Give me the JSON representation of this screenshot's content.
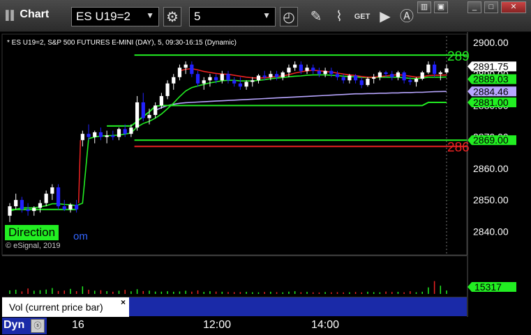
{
  "window": {
    "title": "Chart",
    "symbol": "ES U19=2",
    "interval": "5"
  },
  "info_line": "* ES U19=2, S&P 500 FUTURES E-MINI (DAY), 5, 09:30-16:15 (Dynamic)",
  "direction_label": "Direction",
  "site_fragment": "om",
  "copyright": "© eSignal, 2019",
  "volume_panel": {
    "label": "Vol (current price bar)",
    "close_icon": "×",
    "value_tag": "15317"
  },
  "bottom": {
    "dyn_label": "Dyn"
  },
  "line_labels": {
    "top_right": "289",
    "red_right": "286"
  },
  "colors": {
    "background": "#000000",
    "up_candle": "#ffffff",
    "down_candle": "#2222ff",
    "green_line": "#22ee22",
    "red_line": "#ee2222",
    "purple_line": "#b8a6ff",
    "price_tag_last": "#ffffff",
    "price_tag_green": "#22ee22",
    "price_tag_purple": "#b8a6ff",
    "axis_text": "#ffffff"
  },
  "chart_data": {
    "type": "candlestick",
    "y_axis": {
      "min": 2833,
      "max": 2902,
      "ticks": [
        2840,
        2850,
        2860,
        2870,
        2880,
        2890,
        2900
      ],
      "tick_labels": [
        "2840.00",
        "2850.00",
        "2860.00",
        "2870.00",
        "2880.00",
        "2890.00",
        "2900.00"
      ]
    },
    "x_axis": {
      "tick_labels": [
        "16",
        "12:00",
        "14:00"
      ]
    },
    "price_tags": [
      {
        "value": 2891.75,
        "label": "2891.75",
        "kind": "last"
      },
      {
        "value": 2889.03,
        "label": "2889.03",
        "kind": "green"
      },
      {
        "value": 2884.46,
        "label": "2884.46",
        "kind": "purple"
      },
      {
        "value": 2881.0,
        "label": "2881.00",
        "kind": "green"
      },
      {
        "value": 2869.0,
        "label": "2869.00",
        "kind": "green"
      }
    ],
    "horizontal_lines": [
      {
        "value": 2896,
        "color": "green",
        "from_bar": 21
      },
      {
        "value": 2869,
        "color": "green",
        "from_bar": 21
      },
      {
        "value": 2867,
        "color": "red",
        "from_bar": 21
      }
    ],
    "candles": [
      [
        2845.0,
        2849.0,
        2843.0,
        2848.0
      ],
      [
        2848.0,
        2852.0,
        2847.0,
        2850.0
      ],
      [
        2850.0,
        2851.0,
        2846.0,
        2847.0
      ],
      [
        2847.0,
        2849.0,
        2845.0,
        2846.5
      ],
      [
        2846.5,
        2848.0,
        2845.0,
        2847.5
      ],
      [
        2847.5,
        2850.0,
        2846.0,
        2849.0
      ],
      [
        2849.0,
        2853.0,
        2848.0,
        2852.0
      ],
      [
        2852.0,
        2855.0,
        2850.0,
        2854.0
      ],
      [
        2854.0,
        2855.0,
        2847.0,
        2848.0
      ],
      [
        2848.0,
        2850.0,
        2846.5,
        2847.0
      ],
      [
        2847.0,
        2849.0,
        2846.0,
        2848.5
      ],
      [
        2848.5,
        2850.0,
        2846.0,
        2847.0
      ],
      [
        2869.0,
        2872.0,
        2867.0,
        2871.0
      ],
      [
        2871.0,
        2874.0,
        2869.0,
        2870.0
      ],
      [
        2870.0,
        2872.0,
        2868.0,
        2871.5
      ],
      [
        2871.5,
        2873.0,
        2869.0,
        2870.0
      ],
      [
        2870.0,
        2872.0,
        2868.0,
        2870.5
      ],
      [
        2870.5,
        2872.0,
        2869.0,
        2870.0
      ],
      [
        2870.0,
        2873.0,
        2869.0,
        2872.5
      ],
      [
        2872.5,
        2874.0,
        2870.0,
        2871.0
      ],
      [
        2871.0,
        2874.0,
        2870.0,
        2873.0
      ],
      [
        2873.0,
        2883.0,
        2872.0,
        2881.0
      ],
      [
        2881.0,
        2884.0,
        2875.0,
        2876.0
      ],
      [
        2876.0,
        2879.0,
        2874.0,
        2877.0
      ],
      [
        2877.0,
        2881.0,
        2876.0,
        2880.0
      ],
      [
        2880.0,
        2884.0,
        2879.0,
        2883.0
      ],
      [
        2883.0,
        2888.0,
        2882.0,
        2887.0
      ],
      [
        2887.0,
        2890.0,
        2885.0,
        2889.0
      ],
      [
        2889.0,
        2893.0,
        2888.0,
        2892.0
      ],
      [
        2892.0,
        2894.0,
        2890.0,
        2893.0
      ],
      [
        2893.0,
        2894.0,
        2889.0,
        2890.0
      ],
      [
        2890.0,
        2891.0,
        2886.0,
        2887.0
      ],
      [
        2887.0,
        2889.0,
        2885.0,
        2888.0
      ],
      [
        2888.0,
        2890.0,
        2886.0,
        2889.0
      ],
      [
        2889.0,
        2890.0,
        2887.0,
        2888.0
      ],
      [
        2888.0,
        2891.0,
        2887.0,
        2890.0
      ],
      [
        2890.0,
        2891.0,
        2887.0,
        2888.0
      ],
      [
        2888.0,
        2889.0,
        2886.0,
        2887.0
      ],
      [
        2887.0,
        2889.0,
        2885.0,
        2886.0
      ],
      [
        2886.0,
        2888.0,
        2885.0,
        2887.5
      ],
      [
        2887.5,
        2889.0,
        2886.0,
        2888.0
      ],
      [
        2888.0,
        2890.0,
        2887.0,
        2889.5
      ],
      [
        2889.5,
        2891.0,
        2888.0,
        2889.0
      ],
      [
        2889.0,
        2891.0,
        2888.0,
        2890.0
      ],
      [
        2890.0,
        2891.0,
        2888.0,
        2889.0
      ],
      [
        2889.0,
        2891.0,
        2888.0,
        2890.5
      ],
      [
        2890.5,
        2893.0,
        2889.0,
        2892.0
      ],
      [
        2892.0,
        2894.0,
        2891.0,
        2893.0
      ],
      [
        2893.0,
        2894.0,
        2890.0,
        2891.0
      ],
      [
        2891.0,
        2893.0,
        2890.0,
        2892.0
      ],
      [
        2892.0,
        2893.0,
        2890.0,
        2891.0
      ],
      [
        2891.0,
        2892.0,
        2889.0,
        2890.0
      ],
      [
        2890.0,
        2892.0,
        2889.0,
        2891.0
      ],
      [
        2891.0,
        2892.0,
        2889.0,
        2890.0
      ],
      [
        2890.0,
        2891.0,
        2888.0,
        2889.0
      ],
      [
        2889.0,
        2890.0,
        2887.0,
        2888.0
      ],
      [
        2888.0,
        2890.0,
        2887.0,
        2889.5
      ],
      [
        2889.5,
        2890.0,
        2887.0,
        2888.0
      ],
      [
        2888.0,
        2889.0,
        2885.5,
        2886.5
      ],
      [
        2886.5,
        2889.0,
        2886.0,
        2888.5
      ],
      [
        2888.5,
        2890.0,
        2887.0,
        2889.0
      ],
      [
        2889.0,
        2891.0,
        2888.0,
        2890.5
      ],
      [
        2890.5,
        2891.0,
        2889.0,
        2890.0
      ],
      [
        2890.0,
        2891.0,
        2888.0,
        2889.0
      ],
      [
        2889.0,
        2891.0,
        2888.0,
        2890.5
      ],
      [
        2890.5,
        2891.0,
        2887.0,
        2888.0
      ],
      [
        2888.0,
        2889.0,
        2886.5,
        2887.5
      ],
      [
        2887.5,
        2889.0,
        2886.0,
        2888.5
      ],
      [
        2888.5,
        2891.0,
        2888.0,
        2890.5
      ],
      [
        2890.5,
        2894.0,
        2890.0,
        2893.0
      ],
      [
        2893.0,
        2894.0,
        2889.0,
        2890.0
      ],
      [
        2890.0,
        2891.0,
        2888.0,
        2890.5
      ],
      [
        2890.5,
        2893.0,
        2890.0,
        2891.75
      ]
    ],
    "green_ma": [
      2846.5,
      2847.0,
      2847.5,
      2847.5,
      2847.5,
      2847.8,
      2848.2,
      2848.8,
      2848.8,
      2848.6,
      2848.5,
      2848.2,
      2849.0,
      2869.5,
      2870.0,
      2870.3,
      2870.4,
      2870.5,
      2870.6,
      2870.9,
      2871.3,
      2873.2,
      2874.3,
      2875.0,
      2876.0,
      2877.3,
      2879.0,
      2880.8,
      2882.8,
      2884.6,
      2885.7,
      2886.2,
      2886.7,
      2887.2,
      2887.5,
      2887.9,
      2888.0,
      2888.0,
      2887.8,
      2887.8,
      2887.8,
      2888.0,
      2888.2,
      2888.5,
      2888.7,
      2888.9,
      2889.1,
      2889.3,
      2889.4,
      2889.6,
      2889.7,
      2889.7,
      2889.7,
      2889.6,
      2889.5,
      2889.3,
      2889.2,
      2889.1,
      2888.9,
      2888.9,
      2888.9,
      2889.0,
      2889.0,
      2889.0,
      2889.0,
      2888.8,
      2888.6,
      2888.5,
      2888.7,
      2889.0,
      2889.0,
      2889.0,
      2889.03
    ],
    "red_ma": [
      null,
      null,
      null,
      null,
      null,
      null,
      null,
      null,
      null,
      null,
      null,
      null,
      null,
      null,
      null,
      null,
      null,
      null,
      null,
      null,
      null,
      null,
      null,
      null,
      null,
      null,
      null,
      null,
      2891.0,
      2891.5,
      2891.7,
      2891.3,
      2890.8,
      2890.5,
      2890.2,
      2890.0,
      2889.9,
      2889.6,
      2889.3,
      2889.0,
      2888.8,
      2888.7,
      2888.8,
      2889.0,
      2889.2,
      2889.4,
      2889.8,
      2890.3,
      2890.7,
      2891.0,
      2891.2,
      2891.0,
      2890.8,
      2890.6,
      2890.3,
      2890.0,
      2889.7,
      2889.5,
      2889.2,
      2889.0,
      2889.0,
      2889.2,
      2889.4,
      2889.6,
      2889.8,
      2889.6,
      2889.3,
      2889.0,
      2889.1,
      2889.5,
      2889.6,
      2889.6,
      2889.7
    ],
    "purple_ma": [
      null,
      null,
      null,
      null,
      null,
      null,
      null,
      null,
      null,
      null,
      null,
      null,
      null,
      null,
      null,
      null,
      null,
      null,
      null,
      null,
      null,
      null,
      null,
      null,
      2878.5,
      2879.3,
      2880.0,
      2880.4,
      2880.7,
      2880.9,
      2881.0,
      2881.1,
      2881.2,
      2881.3,
      2881.4,
      2881.5,
      2881.6,
      2881.7,
      2881.8,
      2881.9,
      2882.0,
      2882.1,
      2882.2,
      2882.3,
      2882.4,
      2882.5,
      2882.6,
      2882.7,
      2882.8,
      2882.9,
      2883.0,
      2883.1,
      2883.2,
      2883.3,
      2883.4,
      2883.5,
      2883.6,
      2883.7,
      2883.7,
      2883.8,
      2883.8,
      2883.9,
      2883.9,
      2884.0,
      2884.0,
      2884.1,
      2884.1,
      2884.2,
      2884.2,
      2884.3,
      2884.4,
      2884.45,
      2884.46
    ],
    "support_step": [
      null,
      null,
      null,
      null,
      null,
      null,
      null,
      null,
      null,
      null,
      null,
      null,
      null,
      null,
      null,
      null,
      2873.5,
      2873.5,
      2873.5,
      2873.5,
      2873.5,
      2875.0,
      2876.5,
      2878.0,
      2879.8,
      2880.0,
      2880.0,
      2880.0,
      2880.0,
      2880.0,
      2880.0,
      2880.0,
      2880.0,
      2880.0,
      2880.0,
      2880.0,
      2880.0,
      2880.0,
      2880.0,
      2880.0,
      2880.0,
      2880.0,
      2880.0,
      2880.0,
      2880.0,
      2880.0,
      2880.0,
      2880.0,
      2880.0,
      2880.0,
      2880.0,
      2880.0,
      2880.0,
      2880.0,
      2880.0,
      2880.0,
      2880.0,
      2880.0,
      2880.0,
      2880.0,
      2880.0,
      2880.0,
      2880.0,
      2880.0,
      2880.0,
      2880.0,
      2880.0,
      2880.0,
      2880.0,
      2881.0,
      2881.0,
      2881.0,
      2881.0
    ],
    "early_support": [
      2847.0,
      2847.0,
      2847.0,
      2847.0,
      2847.0,
      2847.0,
      2847.0,
      2847.0,
      2847.0,
      2847.0,
      2847.0,
      2847.0
    ],
    "volume": {
      "max": 45000,
      "values": [
        4200,
        5000,
        3000,
        6500,
        3800,
        4400,
        5200,
        7000,
        3500,
        4000,
        6000,
        3300,
        9000,
        5000,
        3800,
        4400,
        3300,
        2600,
        3800,
        4800,
        3100,
        5600,
        3400,
        3900,
        2800,
        2700,
        3200,
        2600,
        2900,
        3800,
        2700,
        4200,
        2400,
        3200,
        2800,
        2600,
        2300,
        2100,
        2200,
        2500,
        2000,
        1900,
        2300,
        2600,
        2100,
        1900,
        2700,
        3200,
        2000,
        2400,
        1900,
        1700,
        2200,
        1900,
        2100,
        1800,
        1900,
        2300,
        1800,
        2600,
        2100,
        1900,
        2800,
        2300,
        2500,
        1900,
        3200,
        2000,
        2600,
        7800,
        15317,
        9800,
        4100
      ]
    }
  }
}
